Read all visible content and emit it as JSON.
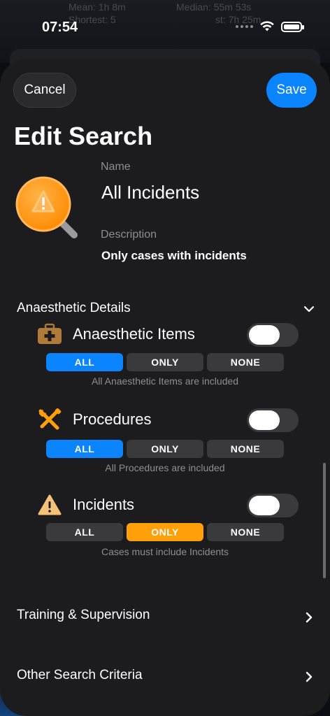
{
  "status_bar": {
    "time": "07:54"
  },
  "background": {
    "stat1": "Mean: 1h 8m",
    "stat2": "Median: 55m 53s",
    "stat3": "Shortest: 5",
    "stat4": "st: 7h 25m"
  },
  "toolbar": {
    "cancel_label": "Cancel",
    "save_label": "Save"
  },
  "page": {
    "title": "Edit Search",
    "name_label": "Name",
    "name_value": "All Incidents",
    "description_label": "Description",
    "description_value": "Only cases with incidents",
    "icon": "warning-magnifier-icon"
  },
  "section": {
    "title": "Anaesthetic Details",
    "items": [
      {
        "label": "Anaesthetic Items",
        "icon": "medical-bag-icon",
        "toggle_on": false,
        "options": [
          "ALL",
          "ONLY",
          "NONE"
        ],
        "selected": "ALL",
        "note": "All Anaesthetic Items are included"
      },
      {
        "label": "Procedures",
        "icon": "tools-icon",
        "toggle_on": false,
        "options": [
          "ALL",
          "ONLY",
          "NONE"
        ],
        "selected": "ALL",
        "note": "All Procedures are included"
      },
      {
        "label": "Incidents",
        "icon": "warning-icon",
        "toggle_on": false,
        "options": [
          "ALL",
          "ONLY",
          "NONE"
        ],
        "selected": "ONLY",
        "note": "Cases must include Incidents"
      }
    ]
  },
  "links": {
    "training": "Training & Supervision",
    "other": "Other Search Criteria"
  },
  "colors": {
    "accent_blue": "#0a84ff",
    "accent_orange": "#ff9f0a",
    "sheet_bg": "#1c1c1e"
  }
}
